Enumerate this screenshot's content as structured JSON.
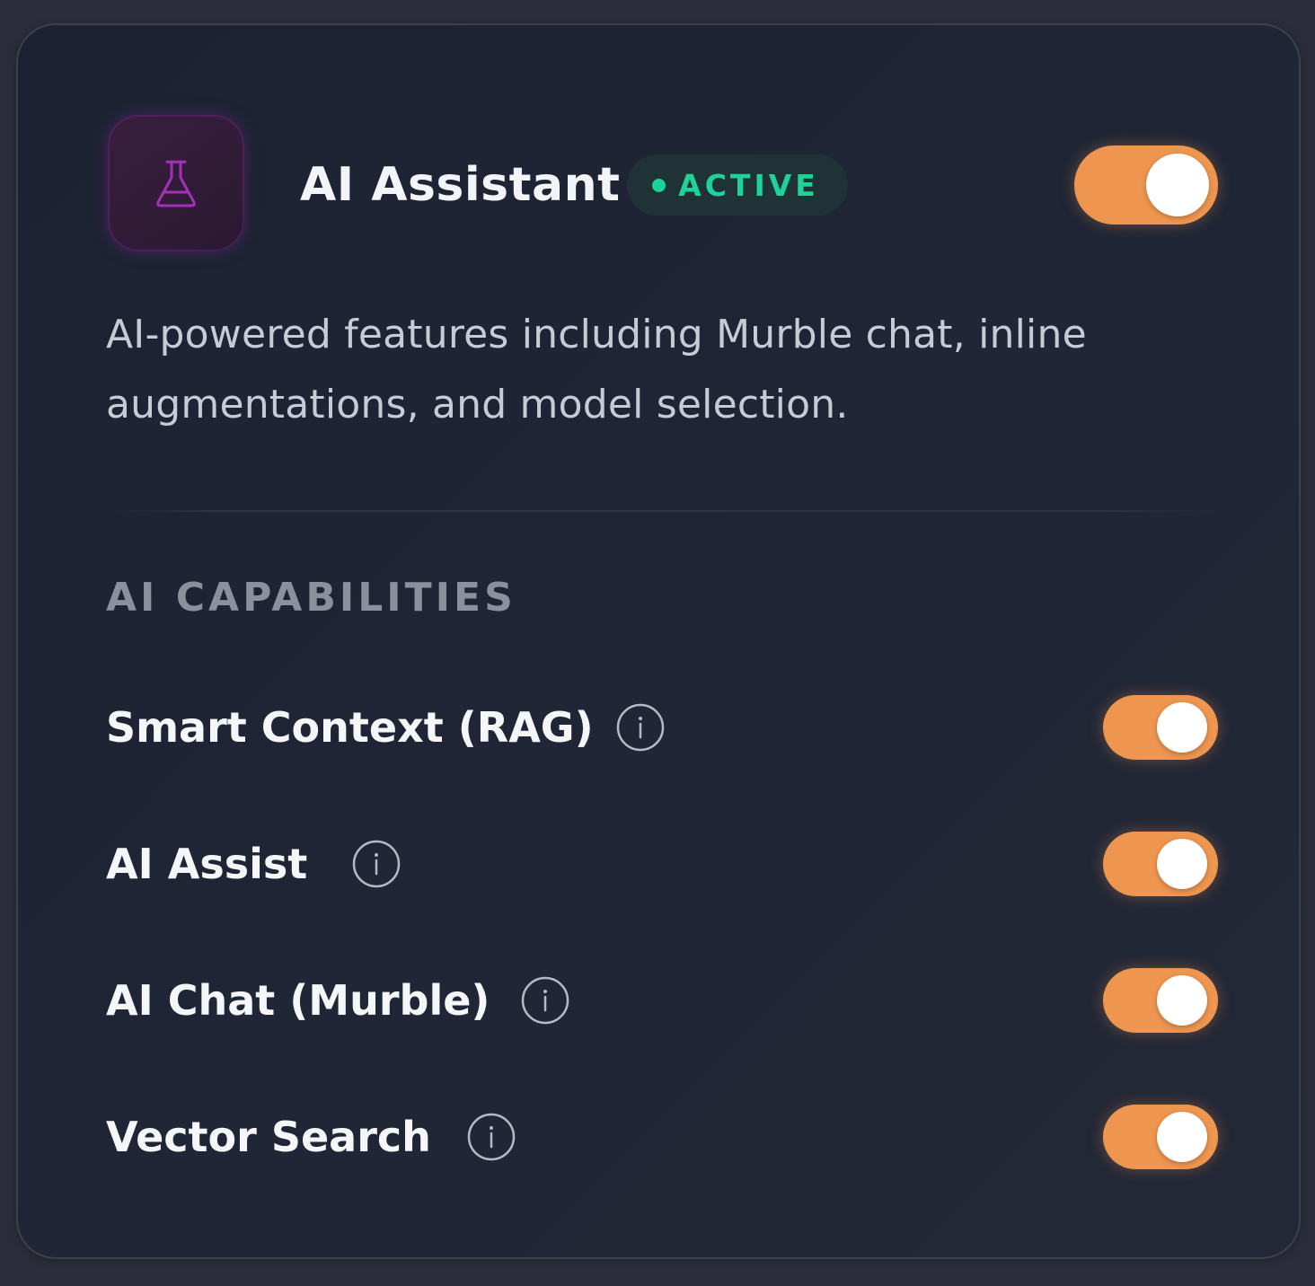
{
  "header": {
    "icon": "flask-icon",
    "title": "AI Assistant",
    "status": "ACTIVE",
    "enabled": true
  },
  "description": "AI-powered features including Murble chat, inline augmentations, and model selection.",
  "section": {
    "label": "AI CAPABILITIES"
  },
  "capabilities": [
    {
      "label": "Smart Context (RAG)",
      "enabled": true,
      "info_icon": "info-icon"
    },
    {
      "label": "AI Assist",
      "enabled": true,
      "info_icon": "info-icon"
    },
    {
      "label": "AI Chat (Murble)",
      "enabled": true,
      "info_icon": "info-icon"
    },
    {
      "label": "Vector Search",
      "enabled": true,
      "info_icon": "info-icon"
    }
  ],
  "colors": {
    "accent": "#ee9650",
    "status": "#1ed39a",
    "icon": "#a42fb8"
  }
}
